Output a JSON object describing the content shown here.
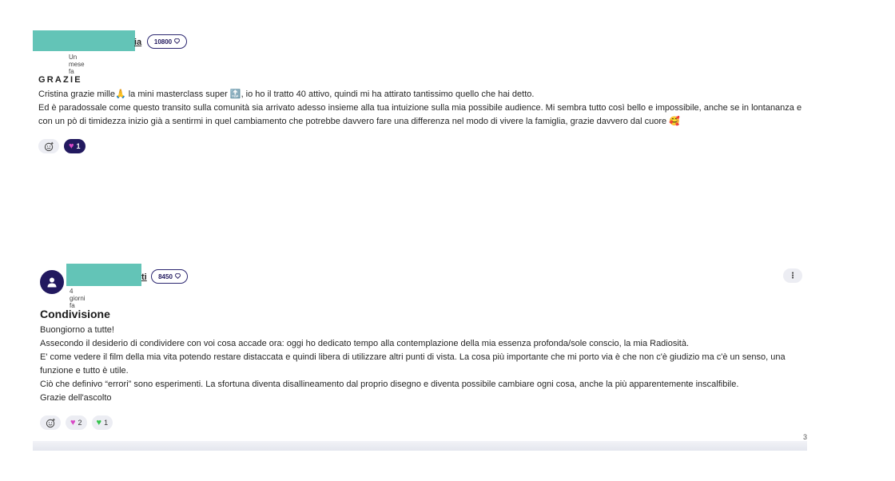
{
  "posts": [
    {
      "author_tail": "ia",
      "points": "10800",
      "time": "Un mese fa",
      "title": "GRAZIE",
      "body": [
        "Cristina grazie mille🙏 la mini masterclass super 🔝, io ho il tratto 40 attivo, quindi mi ha attirato tantissimo quello che hai detto.",
        "Ed è paradossale come questo transito sulla comunità sia arrivato adesso insieme alla tua intuizione sulla mia possibile audience. Mi sembra tutto così bello e impossibile, anche se in lontananza  e con un pò di timidezza inizio già a sentirmi in quel cambiamento che potrebbe davvero fare una differenza nel modo di vivere la famiglia, grazie davvero dal cuore 🥰"
      ],
      "reactions": [
        {
          "icon": "pink-heart-icon",
          "count": "1",
          "active": true
        }
      ]
    },
    {
      "author_tail": "ti",
      "points": "8450",
      "time": "4 giorni fa",
      "title": "Condivisione",
      "body": [
        "Buongiorno a tutte!",
        "Assecondo il desiderio di condividere con voi cosa accade ora: oggi ho dedicato tempo alla contemplazione della mia essenza profonda/sole conscio, la mia Radiosità.",
        "E' come vedere il film della mia vita potendo restare distaccata e quindi libera di utilizzare altri punti di vista. La cosa più importante che mi porto via è che non c'è giudizio ma c'è un senso, una funzione e tutto è utile.",
        "Ciò che definivo “errori” sono esperimenti. La sfortuna diventa disallineamento dal proprio disegno e diventa possibile cambiare ogni cosa, anche la più apparentemente inscalfibile.",
        "Grazie dell'ascolto"
      ],
      "reactions": [
        {
          "icon": "pink-heart-icon",
          "count": "2",
          "active": false
        },
        {
          "icon": "green-heart-icon",
          "count": "1",
          "active": false
        }
      ]
    }
  ],
  "ui": {
    "kebab_glyph": "⋮",
    "gem_glyph": "💎",
    "edge_char": "3"
  },
  "colors": {
    "accent": "#22195f",
    "redaction": "#63c4b7",
    "pill_bg": "#ecedf3"
  }
}
